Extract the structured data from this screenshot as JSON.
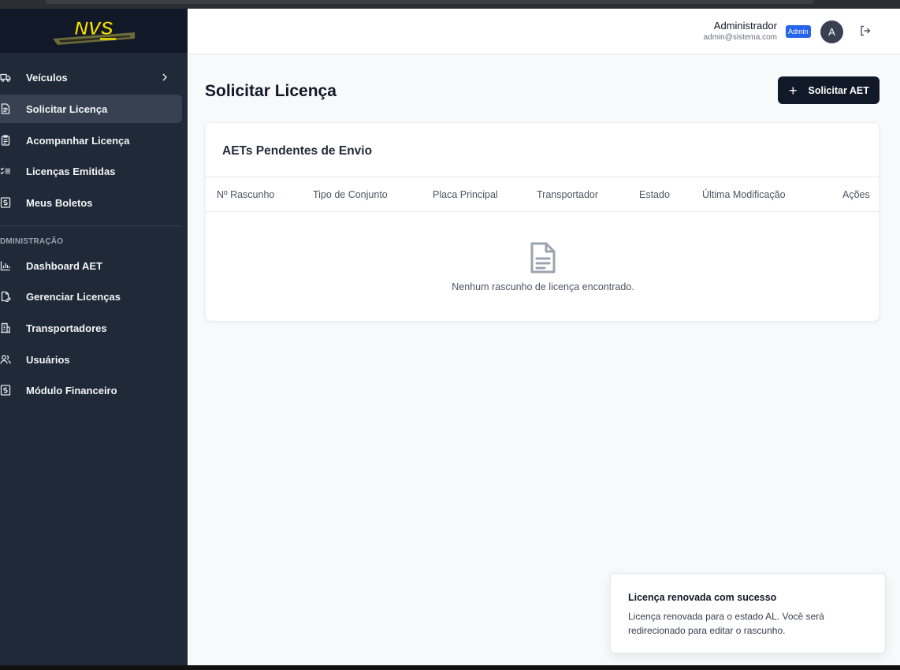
{
  "brand": {
    "logo_text": "NVS"
  },
  "sidebar": {
    "items": [
      {
        "label": "Veículos",
        "icon": "truck-icon",
        "has_submenu": true
      },
      {
        "label": "Solicitar Licença",
        "icon": "file-text-icon",
        "active": true
      },
      {
        "label": "Acompanhar Licença",
        "icon": "clipboard-list-icon"
      },
      {
        "label": "Licenças Emitidas",
        "icon": "list-checks-icon"
      },
      {
        "label": "Meus Boletos",
        "icon": "receipt-dollar-icon"
      }
    ],
    "section_label": "DMINISTRAÇÃO",
    "admin_items": [
      {
        "label": "Dashboard AET",
        "icon": "bar-chart-icon"
      },
      {
        "label": "Gerenciar Licenças",
        "icon": "file-signature-icon"
      },
      {
        "label": "Transportadores",
        "icon": "building-icon"
      },
      {
        "label": "Usuários",
        "icon": "users-icon"
      },
      {
        "label": "Módulo Financeiro",
        "icon": "receipt-dollar-icon"
      }
    ]
  },
  "header": {
    "user_name": "Administrador",
    "user_email": "admin@sistema.com",
    "role_badge": "Admin",
    "avatar_initial": "A",
    "logout_icon": "log-out-icon"
  },
  "main": {
    "page_title": "Solicitar Licença",
    "primary_button": "Solicitar AET",
    "card_title": "AETs Pendentes de Envio",
    "columns": [
      "Nº Rascunho",
      "Tipo de Conjunto",
      "Placa Principal",
      "Transportador",
      "Estado",
      "Última Modificação",
      "Ações"
    ],
    "empty_icon": "file-text-icon",
    "empty_message": "Nenhum rascunho de licença encontrado."
  },
  "toast": {
    "title": "Licença renovada com sucesso",
    "body": "Licença renovada para o estado AL. Você será redirecionado para editar o rascunho."
  },
  "colors": {
    "sidebar_bg": "#1f2937",
    "logo_bg": "#111827",
    "active_item_bg": "#374151",
    "primary_button_bg": "#111827",
    "badge_bg": "#2563eb",
    "logo_yellow": "#f5e100"
  }
}
